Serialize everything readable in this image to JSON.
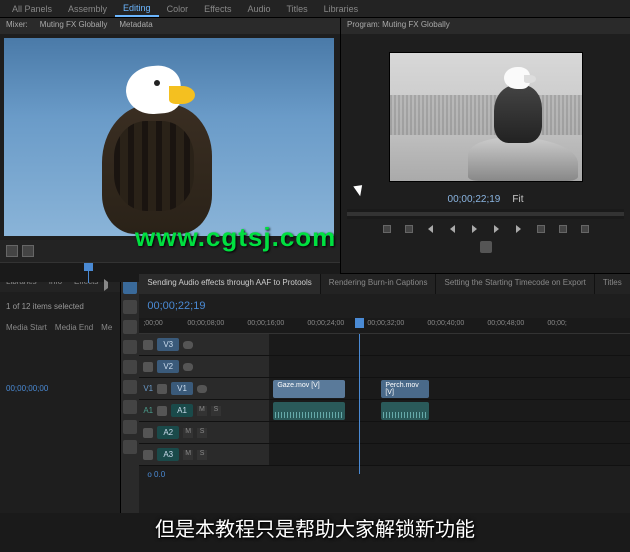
{
  "topbar": {
    "tabs": [
      "All Panels",
      "Assembly",
      "Editing",
      "Color",
      "Effects",
      "Audio",
      "Titles",
      "Libraries"
    ],
    "active": "Editing"
  },
  "source": {
    "title_prefix": "Mixer:",
    "title": "Muting FX Globally",
    "tabs": [
      "Metadata"
    ]
  },
  "program": {
    "title_prefix": "Program:",
    "title": "Muting FX Globally",
    "timecode": "00;00;22;19",
    "fit": "Fit"
  },
  "watermark": "www.cgtsj.com",
  "project": {
    "tabs": [
      "Libraries",
      "Info",
      "Effects"
    ],
    "selection": "1 of 12 items selected",
    "cols": [
      "Media Start",
      "Media End",
      "Me"
    ],
    "tc": "00;00;00;00"
  },
  "sequence": {
    "tabs": [
      "Sending Audio effects through AAF to Protools",
      "Rendering Burn-in Captions",
      "Setting the Starting Timecode on Export",
      "Titles"
    ],
    "active": 0,
    "timecode": "00;00;22;19",
    "ruler": [
      ";00;00",
      "00;00;08;00",
      "00;00;16;00",
      "00;00;24;00",
      "00;00;32;00",
      "00;00;40;00",
      "00;00;48;00",
      "00;00;"
    ],
    "tracks": {
      "v3": "V3",
      "v2": "V2",
      "v1": "V1",
      "a1": "A1",
      "a2": "A2",
      "a3": "A3"
    },
    "clips": {
      "v1a": "Gaze.mov [V]",
      "v1b": "Perch.mov [V]"
    },
    "mute": "M",
    "solo": "S",
    "zoom": "0.0"
  },
  "subtitle": "但是本教程只是帮助大家解锁新功能"
}
